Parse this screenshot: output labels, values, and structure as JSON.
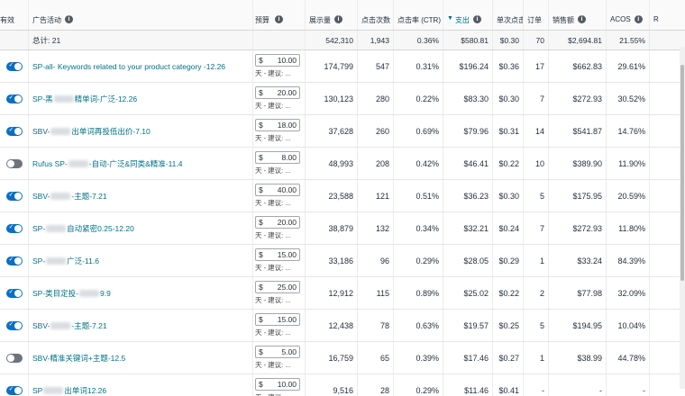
{
  "header": {
    "active": "有效",
    "campaign": "广告活动",
    "budget": "预算",
    "impressions": "展示量",
    "clicks": "点击次数",
    "ctr": "点击率 (CTR)",
    "spend": "支出",
    "cpc": "单次点击",
    "orders": "订单",
    "sales": "销售额",
    "acos": "ACOS",
    "extra": "R"
  },
  "total": {
    "label": "总计: 21",
    "impressions": "542,310",
    "clicks": "1,943",
    "ctr": "0.36%",
    "spend": "$580.81",
    "cpc": "$0.30",
    "orders": "70",
    "sales": "$2,694.81",
    "acos": "21.55%"
  },
  "budget_currency": "$",
  "budget_note": "天 - 建议: ...",
  "rows": [
    {
      "active": true,
      "name_a": "SP-all- Keywords related to your product category -12.26",
      "name_b": "",
      "budget": "10.00",
      "impressions": "174,799",
      "clicks": "547",
      "ctr": "0.31%",
      "spend": "$196.24",
      "cpc": "$0.36",
      "orders": "17",
      "sales": "$662.83",
      "acos": "29.61%"
    },
    {
      "active": true,
      "name_a": "SP-黑",
      "name_b": "精单词-广泛-12.26",
      "budget": "20.00",
      "impressions": "130,123",
      "clicks": "280",
      "ctr": "0.22%",
      "spend": "$83.30",
      "cpc": "$0.30",
      "orders": "7",
      "sales": "$272.93",
      "acos": "30.52%"
    },
    {
      "active": true,
      "name_a": "SBV-",
      "name_b": "出单词再投低出价-7.10",
      "budget": "18.00",
      "impressions": "37,628",
      "clicks": "260",
      "ctr": "0.69%",
      "spend": "$79.96",
      "cpc": "$0.31",
      "orders": "14",
      "sales": "$541.87",
      "acos": "14.76%"
    },
    {
      "active": false,
      "name_a": "Rufus SP-",
      "name_b": "-自动-广泛&同类&精准-11.4",
      "budget": "8.00",
      "impressions": "48,993",
      "clicks": "208",
      "ctr": "0.42%",
      "spend": "$46.41",
      "cpc": "$0.22",
      "orders": "10",
      "sales": "$389.90",
      "acos": "11.90%"
    },
    {
      "active": true,
      "name_a": "SBV-",
      "name_b": "-主题-7.21",
      "budget": "40.00",
      "impressions": "23,588",
      "clicks": "121",
      "ctr": "0.51%",
      "spend": "$36.23",
      "cpc": "$0.30",
      "orders": "5",
      "sales": "$175.95",
      "acos": "20.59%"
    },
    {
      "active": true,
      "name_a": "SP-",
      "name_b": "自动紧密0.25-12.20",
      "budget": "20.00",
      "impressions": "38,879",
      "clicks": "132",
      "ctr": "0.34%",
      "spend": "$32.21",
      "cpc": "$0.24",
      "orders": "7",
      "sales": "$272.93",
      "acos": "11.80%"
    },
    {
      "active": true,
      "name_a": "SP-",
      "name_b": "广泛-11.6",
      "budget": "15.00",
      "impressions": "33,186",
      "clicks": "96",
      "ctr": "0.29%",
      "spend": "$28.05",
      "cpc": "$0.29",
      "orders": "1",
      "sales": "$33.24",
      "acos": "84.39%"
    },
    {
      "active": true,
      "name_a": "SP-类目定投-",
      "name_b": "9.9",
      "budget": "25.00",
      "impressions": "12,912",
      "clicks": "115",
      "ctr": "0.89%",
      "spend": "$25.02",
      "cpc": "$0.22",
      "orders": "2",
      "sales": "$77.98",
      "acos": "32.09%"
    },
    {
      "active": true,
      "name_a": "SBV-",
      "name_b": "-主题-7.21",
      "budget": "15.00",
      "impressions": "12,438",
      "clicks": "78",
      "ctr": "0.63%",
      "spend": "$19.57",
      "cpc": "$0.25",
      "orders": "5",
      "sales": "$194.95",
      "acos": "10.04%"
    },
    {
      "active": false,
      "name_a": "SBV-精准关键词+主题-12.5",
      "name_b": "",
      "budget": "5.00",
      "impressions": "16,759",
      "clicks": "65",
      "ctr": "0.39%",
      "spend": "$17.46",
      "cpc": "$0.27",
      "orders": "1",
      "sales": "$38.99",
      "acos": "44.78%"
    },
    {
      "active": true,
      "name_a": "SP",
      "name_b": "出单词12.26",
      "budget": "10.00",
      "impressions": "9,516",
      "clicks": "28",
      "ctr": "0.29%",
      "spend": "$11.46",
      "cpc": "$0.41",
      "orders": "-",
      "sales": "-",
      "acos": "-"
    }
  ],
  "colors": {
    "link": "#007185",
    "toggle_on": "#0a6fc2",
    "toggle_off": "#6d747d"
  },
  "icons": {
    "info": "info-icon",
    "sort": "sort-down-icon"
  }
}
